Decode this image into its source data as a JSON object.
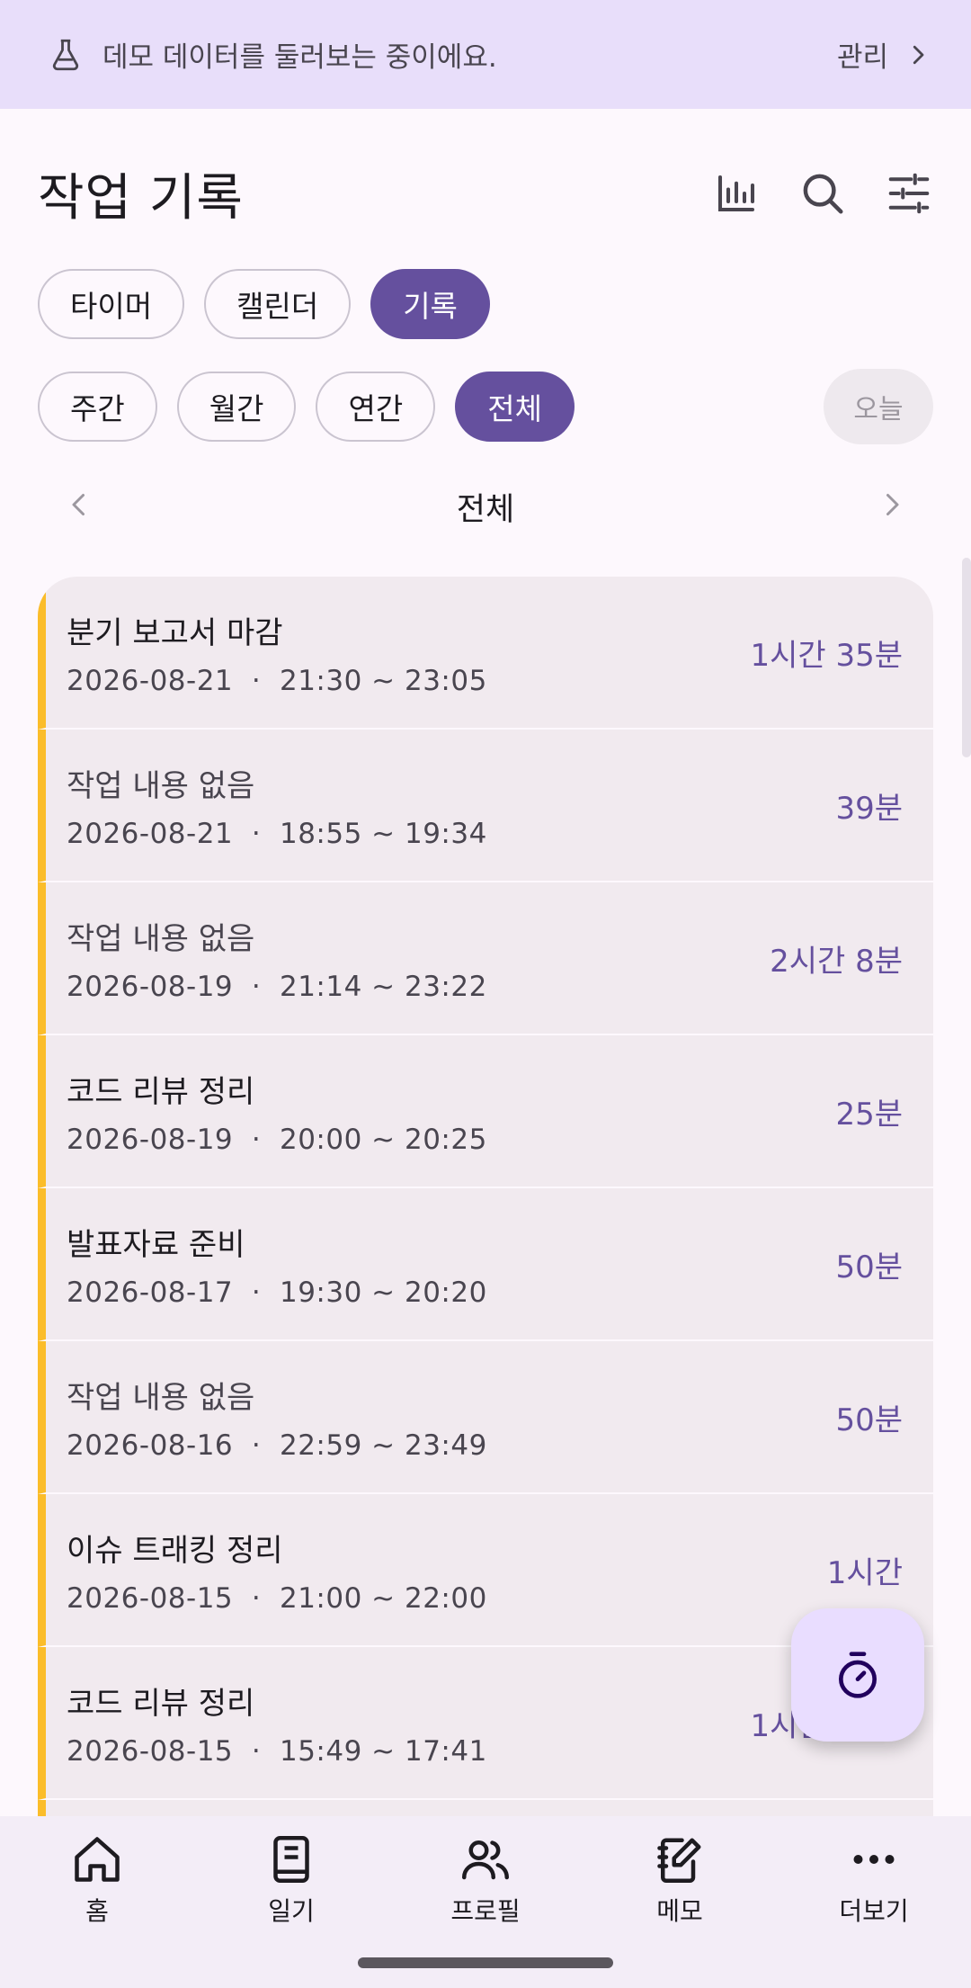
{
  "banner": {
    "message": "데모 데이터를 둘러보는 중이에요.",
    "action": "관리"
  },
  "header": {
    "title": "작업 기록"
  },
  "view_tabs": [
    "타이머",
    "캘린더",
    "기록"
  ],
  "view_tabs_active": 2,
  "range_tabs": [
    "주간",
    "월간",
    "연간",
    "전체"
  ],
  "range_tabs_active": 3,
  "today_button": "오늘",
  "period_label": "전체",
  "records": [
    {
      "title": "분기 보고서 마감",
      "date": "2026-08-21",
      "sep": "·",
      "range": "21:30 ~ 23:05",
      "duration": "1시간 35분"
    },
    {
      "title": "작업 내용 없음",
      "date": "2026-08-21",
      "sep": "·",
      "range": "18:55 ~ 19:34",
      "duration": "39분"
    },
    {
      "title": "작업 내용 없음",
      "date": "2026-08-19",
      "sep": "·",
      "range": "21:14 ~ 23:22",
      "duration": "2시간 8분"
    },
    {
      "title": "코드 리뷰 정리",
      "date": "2026-08-19",
      "sep": "·",
      "range": "20:00 ~ 20:25",
      "duration": "25분"
    },
    {
      "title": "발표자료 준비",
      "date": "2026-08-17",
      "sep": "·",
      "range": "19:30 ~ 20:20",
      "duration": "50분"
    },
    {
      "title": "작업 내용 없음",
      "date": "2026-08-16",
      "sep": "·",
      "range": "22:59 ~ 23:49",
      "duration": "50분"
    },
    {
      "title": "이슈 트래킹 정리",
      "date": "2026-08-15",
      "sep": "·",
      "range": "21:00 ~ 22:00",
      "duration": "1시간"
    },
    {
      "title": "코드 리뷰 정리",
      "date": "2026-08-15",
      "sep": "·",
      "range": "15:49 ~ 17:41",
      "duration": "1시간 52분"
    }
  ],
  "bottom_nav": [
    "홈",
    "일기",
    "프로필",
    "메모",
    "더보기"
  ],
  "colors": {
    "accent": "#65509e",
    "stripe": "#fbbd2a",
    "banner": "#e8defa",
    "fab": "#e9ddff"
  },
  "icons": {
    "banner": "flask-icon",
    "banner_action": "chevron-right-icon",
    "header": [
      "bar-chart-icon",
      "search-icon",
      "tune-icon"
    ],
    "fab": "stopwatch-icon",
    "bottom_nav": [
      "home-icon",
      "book-icon",
      "people-icon",
      "note-edit-icon",
      "more-horiz-icon"
    ]
  }
}
